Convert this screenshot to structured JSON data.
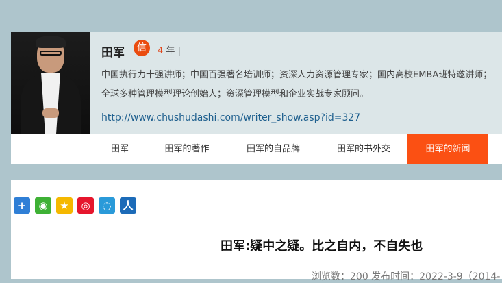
{
  "profile": {
    "name": "田军",
    "badge": "信",
    "years_num": "4",
    "years_suffix": " 年 |",
    "bio": "中国执行力十强讲师；中国百强著名培训师；资深人力资源管理专家；国内高校EMBA班特邀讲师；全球多种管理模型理论创始人；资深管理模型和企业实战专家顾问。",
    "link": "http://www.chushudashi.com/writer_show.asp?id=327"
  },
  "nav": {
    "items": [
      {
        "label": "田军"
      },
      {
        "label": "田军的著作"
      },
      {
        "label": "田军的自品牌"
      },
      {
        "label": "田军的书外交"
      },
      {
        "label": "田军的新闻"
      }
    ],
    "active_index": 4
  },
  "share": {
    "icons": [
      {
        "name": "plus-share-icon",
        "glyph": "+",
        "color": "#2f7fd6"
      },
      {
        "name": "wechat-icon",
        "glyph": "◉",
        "color": "#3eb135"
      },
      {
        "name": "qzone-icon",
        "glyph": "★",
        "color": "#f5b800"
      },
      {
        "name": "weibo-icon",
        "glyph": "◎",
        "color": "#e6162d"
      },
      {
        "name": "tencent-weibo-icon",
        "glyph": "◌",
        "color": "#2a9ad9"
      },
      {
        "name": "renren-icon",
        "glyph": "人",
        "color": "#1c6bb8"
      }
    ]
  },
  "article": {
    "title": "田军:疑中之疑。比之自内，不自失也",
    "meta": "浏览数：200   发布时间：2022-3-9（2014-"
  },
  "colors": {
    "accent": "#fb5013",
    "badge": "#ea4c10",
    "link": "#1e5f8e",
    "page_bg": "#aec5cc"
  }
}
